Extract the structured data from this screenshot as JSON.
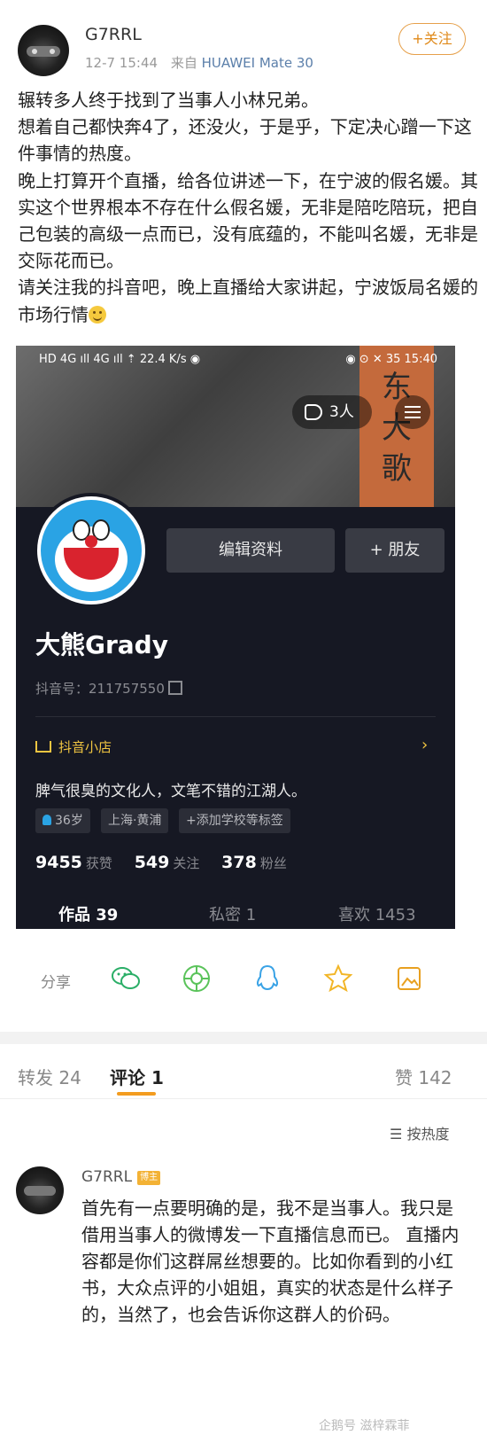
{
  "post": {
    "username": "G7RRL",
    "time": "12-7 15:44",
    "source_prefix": "来自",
    "device": "HUAWEI Mate 30",
    "follow_label": "+关注",
    "paragraphs": [
      "辗转多人终于找到了当事人小林兄弟。",
      "想着自己都快奔4了，还没火，于是乎，下定决心蹭一下这件事情的热度。",
      "晚上打算开个直播，给各位讲述一下，在宁波的假名媛。其实这个世界根本不存在什么假名媛，无非是陪吃陪玩，把自己包装的高级一点而已，没有底蕴的，不能叫名媛，无非是交际花而已。",
      "请关注我的抖音吧，晚上直播给大家讲起，宁波饭局名媛的市场行情"
    ]
  },
  "screenshot": {
    "status_left": "HD 4G ıll 4G ıll ⇡  22.4 K/s  ◉",
    "status_right": "◉ ⊙ ✕ 35 15:40",
    "calligraphy": "东 大 歌",
    "likes_count": "3人",
    "edit_profile": "编辑资料",
    "add_friend": "+ 朋友",
    "display_name": "大熊Grady",
    "douyin_id": "抖音号：211757550",
    "shop_label": "抖音小店",
    "shop_arrow": "›",
    "bio": "脾气很臭的文化人，文笔不错的江湖人。",
    "tag_age": "36岁",
    "tag_location": "上海·黄浦",
    "tag_school": "+添加学校等标签",
    "stats": [
      {
        "value": "9455",
        "label": "获赞"
      },
      {
        "value": "549",
        "label": "关注"
      },
      {
        "value": "378",
        "label": "粉丝"
      }
    ],
    "tabs": {
      "works": "作品 39",
      "private": "私密 1",
      "likes": "喜欢 1453"
    }
  },
  "share": {
    "label": "分享",
    "icons": [
      "wechat-icon",
      "moments-icon",
      "qq-icon",
      "qzone-icon",
      "save-image-icon"
    ],
    "colors": {
      "wechat": "#2aae67",
      "moments": "#5ac35a",
      "qq": "#3aa3e6",
      "qzone": "#f2b526",
      "save": "#e8a020"
    }
  },
  "comments_bar": {
    "repost": "转发 24",
    "comment": "评论 1",
    "likes": "赞 142",
    "sort": "按热度",
    "accent": "#f39c1f"
  },
  "comment": {
    "username": "G7RRL",
    "badge": "博主",
    "text": "首先有一点要明确的是，我不是当事人。我只是借用当事人的微博发一下直播信息而已。 直播内容都是你们这群屌丝想要的。比如你看到的小红书，大众点评的小姐姐，真实的状态是什么样子的，当然了，也会告诉你这群人的价码。"
  },
  "watermark": "企鹅号 滋梓霖菲"
}
